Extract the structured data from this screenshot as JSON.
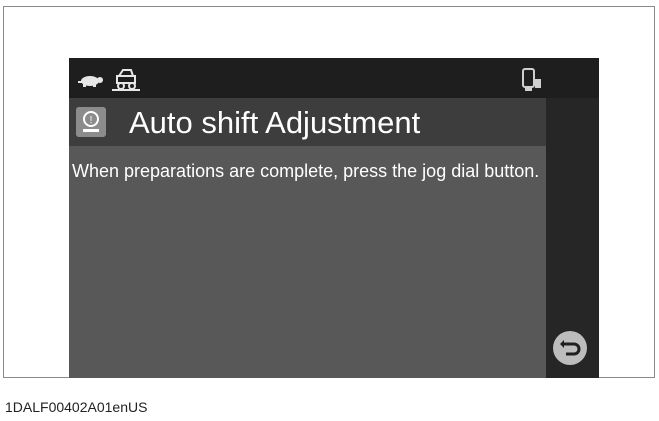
{
  "screen": {
    "status_icons": [
      "turtle-icon",
      "machine-icon",
      "device-icon"
    ],
    "title": "Auto shift Adjustment",
    "title_icon": "settings-badge-icon",
    "message": "When preparations are complete, press the jog dial button.",
    "back_button_icon": "return-arrow-icon"
  },
  "caption": "1DALF00402A01enUS",
  "colors": {
    "screen_background": "#2b2b2b",
    "panel_background": "#585858",
    "title_bar_background": "#3d3d3d",
    "text": "#ffffff"
  }
}
